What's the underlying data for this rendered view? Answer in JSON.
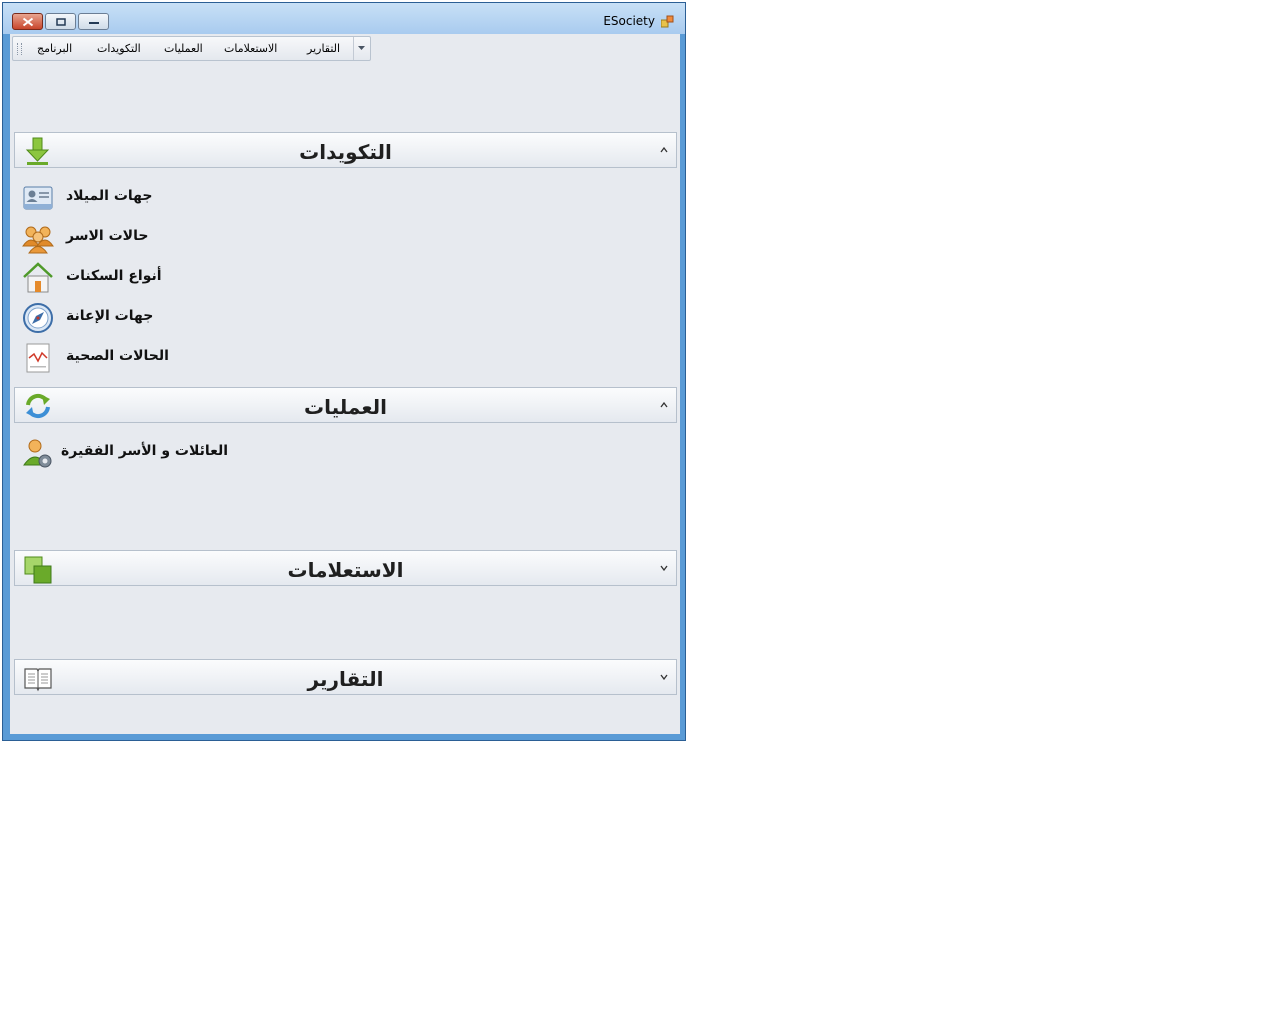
{
  "window": {
    "title": "ESociety",
    "controls": {
      "close": "close-icon",
      "maximize": "maximize-icon",
      "minimize": "minimize-icon"
    }
  },
  "menu": {
    "items": [
      {
        "label": "البرنامج"
      },
      {
        "label": "التكويدات"
      },
      {
        "label": "العمليات"
      },
      {
        "label": "الاستعلامات"
      },
      {
        "label": "التقارير"
      }
    ]
  },
  "groups": [
    {
      "title": "التكويدات",
      "icon": "download-arrow-icon",
      "expanded": true,
      "items": [
        {
          "label": "جهات الميلاد",
          "icon": "id-card-icon"
        },
        {
          "label": "حالات الاسر",
          "icon": "people-group-icon"
        },
        {
          "label": "أنواع السكنات",
          "icon": "house-icon"
        },
        {
          "label": "جهات الإعانة",
          "icon": "compass-icon"
        },
        {
          "label": "الحالات الصحية",
          "icon": "health-chart-icon"
        }
      ]
    },
    {
      "title": "العمليات",
      "icon": "refresh-arrows-icon",
      "expanded": true,
      "items": [
        {
          "label": "العائلات و الأسر الفقيرة",
          "icon": "user-settings-icon"
        }
      ]
    },
    {
      "title": "الاستعلامات",
      "icon": "green-squares-icon",
      "expanded": false,
      "items": []
    },
    {
      "title": "التقارير",
      "icon": "open-book-icon",
      "expanded": false,
      "items": []
    }
  ],
  "colors": {
    "title_bar": "#b7d3f1",
    "client_background": "#e7eaef",
    "close_button": "#c8462c"
  }
}
